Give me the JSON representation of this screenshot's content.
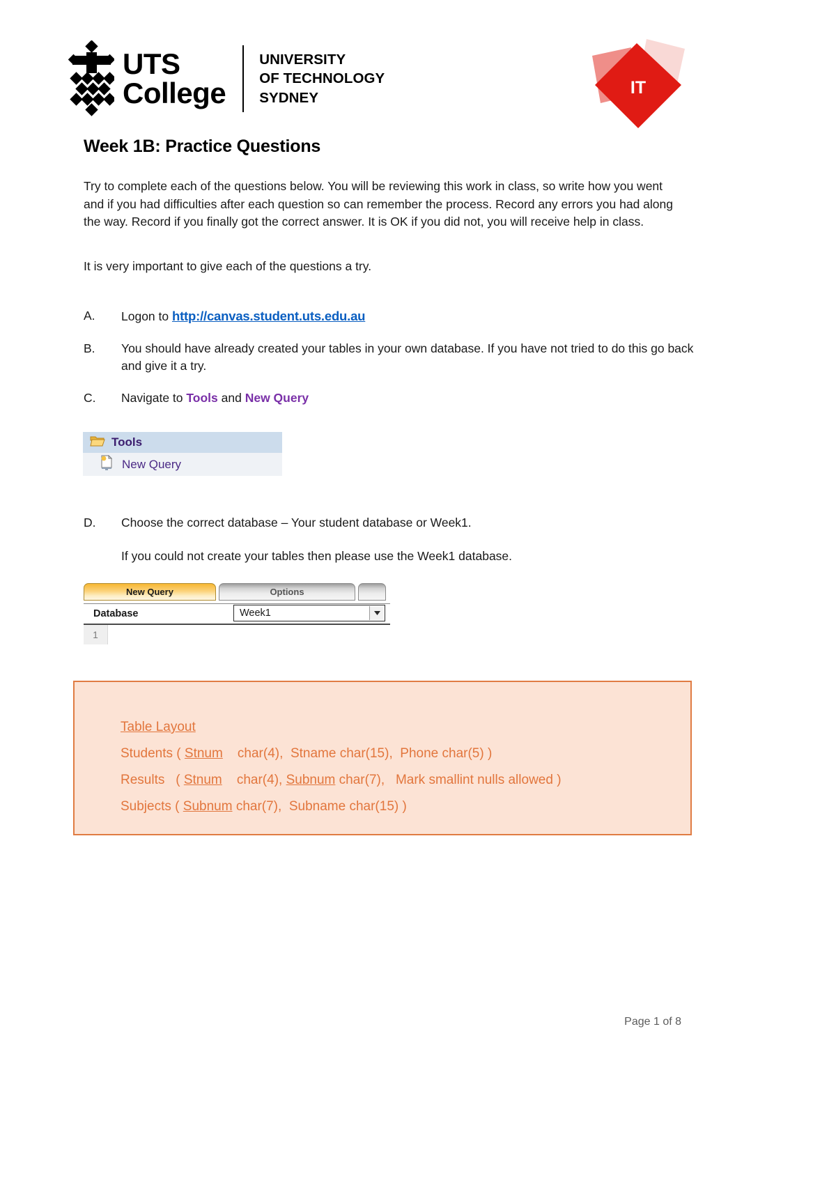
{
  "header": {
    "logo": {
      "line1": "UTS",
      "line2": "College",
      "sub_line1": "UNIVERSITY",
      "sub_line2": "OF TECHNOLOGY",
      "sub_line3": "SYDNEY",
      "mark_icon": "uts-diamond-mark-icon"
    },
    "badge": {
      "text": "IT",
      "icon": "it-diamond-badge-icon",
      "color_main": "#e01b14",
      "color_mid": "#ef8e89",
      "color_light": "#f9d9d6"
    }
  },
  "document": {
    "title": "Week 1B: Practice Questions",
    "paragraph_1": "Try to complete each of the questions below. You will be reviewing this work in class, so write how you went and if you had difficulties after each question so can remember the process. Record any errors you had along the way. Record if you finally got the correct answer. It is OK if you did not, you will receive help in class.",
    "paragraph_2": "It is very important to give each of the questions a try.",
    "items": [
      {
        "marker": "A.",
        "text_before": "Logon to ",
        "link_text": "http://canvas.student.uts.edu.au",
        "link_color": "#0b5fc1"
      },
      {
        "marker": "B.",
        "text": "You should have already created your tables in your own database. If you have not tried to do this go back and give it a try."
      },
      {
        "marker": "C.",
        "text_before": "Navigate to ",
        "highlight_1": "Tools",
        "text_middle": " and ",
        "highlight_2": "New Query",
        "highlight_color": "#7a30a8"
      },
      {
        "marker": "D.",
        "text": "Choose the correct database – Your student database or Week1.",
        "sub_text": "If you could not create your tables then please use the Week1 database."
      }
    ]
  },
  "tools_widget": {
    "header_label": "Tools",
    "header_icon": "open-folder-icon",
    "header_bg": "#ccdcec",
    "item_label": "New Query",
    "item_icon": "new-query-document-icon",
    "item_bg": "#eff2f6",
    "text_color": "#4b2a86"
  },
  "new_query_widget": {
    "tabs": [
      {
        "label": "New Query",
        "active": true
      },
      {
        "label": "Options",
        "active": false
      },
      {
        "label": "",
        "active": false
      }
    ],
    "database_label": "Database",
    "database_value": "Week1",
    "database_options": [
      "Week1"
    ],
    "dropdown_icon": "chevron-down-icon",
    "line_number": "1",
    "active_tab_color": "#f7b733"
  },
  "table_layout": {
    "title": "Table Layout",
    "border_color": "#e07c43",
    "background_color": "#fce3d5",
    "text_color": "#e2763d",
    "rows": [
      {
        "parts": [
          {
            "t": "Students ( ",
            "u": false
          },
          {
            "t": "Stnum",
            "u": true
          },
          {
            "t": "    char(4),  Stname char(15),  Phone char(5) )",
            "u": false
          }
        ]
      },
      {
        "parts": [
          {
            "t": "Results   ( ",
            "u": false
          },
          {
            "t": "Stnum",
            "u": true
          },
          {
            "t": "    char(4), ",
            "u": false
          },
          {
            "t": "Subnum",
            "u": true
          },
          {
            "t": " char(7),   Mark smallint nulls allowed )",
            "u": false
          }
        ]
      },
      {
        "parts": [
          {
            "t": "Subjects ( ",
            "u": false
          },
          {
            "t": "Subnum",
            "u": true
          },
          {
            "t": " char(7),  Subname char(15) )",
            "u": false
          }
        ]
      }
    ]
  },
  "footer": {
    "page_text": "Page 1 of 8"
  }
}
